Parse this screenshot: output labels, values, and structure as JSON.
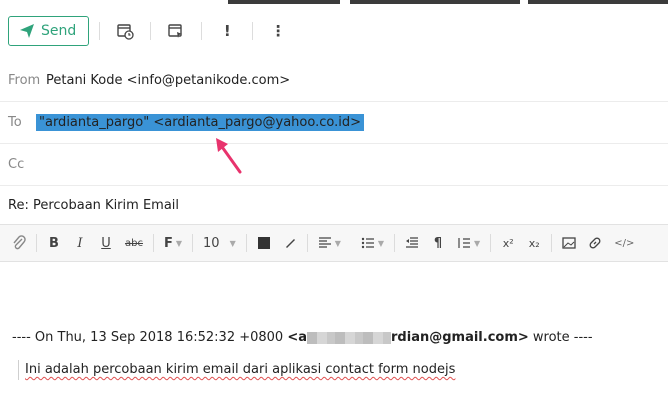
{
  "toolbar": {
    "send_label": "Send",
    "buttons": [
      "schedule-icon",
      "template-icon",
      "priority-icon",
      "more-icon"
    ],
    "priority_glyph": "!",
    "more_glyph": "⋮"
  },
  "header": {
    "from_label": "From",
    "from_value": "Petani Kode <info@petanikode.com>",
    "to_label": "To",
    "to_value": "\"ardianta_pargo\" <ardianta_pargo@yahoo.co.id>",
    "cc_label": "Cc",
    "cc_value": "",
    "subject": "Re: Percobaan Kirim Email"
  },
  "format_bar": {
    "font_size": "10",
    "bold": "B",
    "italic": "I",
    "underline": "U",
    "strike": "abc",
    "font": "F",
    "superscript": "x²",
    "subscript": "x₂",
    "code": "</>"
  },
  "quote": {
    "prefix": "---- On Thu, 13 Sep 2018 16:52:32 +0800 ",
    "email_start": "<a",
    "email_end": "rdian@gmail.com>",
    "suffix": " wrote ----",
    "body": "Ini adalah percobaan kirim email dari aplikasi contact form nodejs"
  },
  "colors": {
    "accent_green": "#2fa37b",
    "selection_blue": "#3a93d6",
    "annotation_arrow": "#e8336d"
  }
}
